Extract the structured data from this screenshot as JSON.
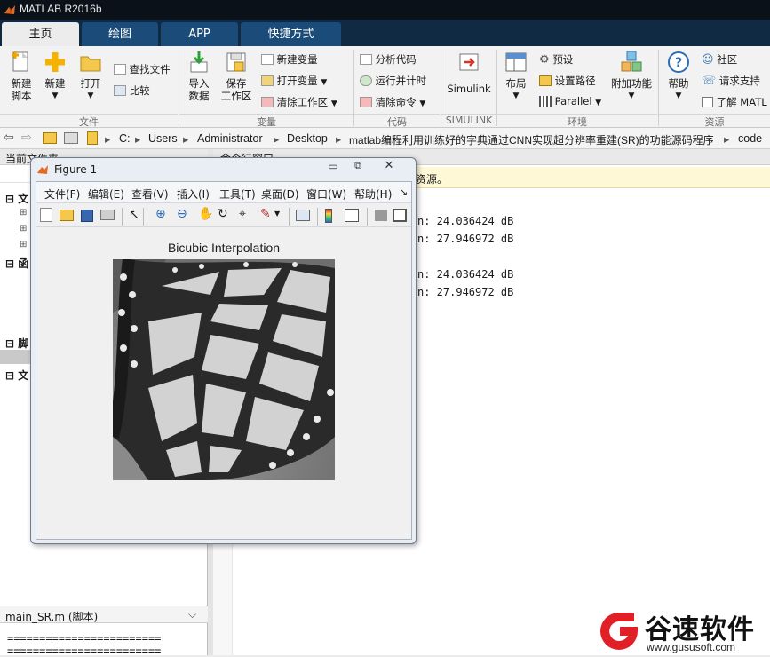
{
  "titlebar": {
    "title": "MATLAB R2016b"
  },
  "tabs": [
    "主页",
    "绘图",
    "APP",
    "快捷方式"
  ],
  "ribbon": {
    "file": {
      "new_script": "新建\n脚本",
      "new": "新建",
      "open": "打开",
      "find_files": "查找文件",
      "compare": "比较",
      "label": "文件"
    },
    "variable": {
      "import": "导入\n数据",
      "save": "保存\n工作区",
      "new_var": "新建变量",
      "open_var": "打开变量",
      "clear_ws": "清除工作区",
      "label": "变量"
    },
    "code": {
      "analyze": "分析代码",
      "run_time": "运行并计时",
      "clear_cmd": "清除命令",
      "label": "代码"
    },
    "simulink": {
      "simulink": "Simulink",
      "label": "SIMULINK"
    },
    "env": {
      "layout": "布局",
      "prefs": "预设",
      "set_path": "设置路径",
      "parallel": "Parallel",
      "addons": "附加功能",
      "label": "环境"
    },
    "resources": {
      "help": "帮助",
      "community": "社区",
      "support": "请求支持",
      "learn": "了解 MATL",
      "label": "资源"
    }
  },
  "address": {
    "segments": [
      "C:",
      "Users",
      "Administrator",
      "Desktop",
      "matlab编程利用训练好的字典通过CNN实现超分辨率重建(SR)的功能源码程序",
      "code"
    ]
  },
  "left_panel": {
    "header": "当前文件夹",
    "sections": [
      "文",
      "函",
      "脚",
      "文"
    ],
    "details_file": "main_SR.m  (脚本)",
    "details_text": "========================"
  },
  "command_window": {
    "header": "命令行窗口",
    "info_bar": "资源。",
    "lines": [
      "n: 24.036424 dB",
      "n: 27.946972 dB",
      "n: 24.036424 dB",
      "n: 27.946972 dB"
    ]
  },
  "figure": {
    "title": "Figure 1",
    "menu": [
      "文件(F)",
      "编辑(E)",
      "查看(V)",
      "插入(I)",
      "工具(T)",
      "桌面(D)",
      "窗口(W)",
      "帮助(H)"
    ],
    "plot_title": "Bicubic Interpolation"
  },
  "watermark": {
    "brand": "谷速软件",
    "url": "www.gususoft.com"
  }
}
